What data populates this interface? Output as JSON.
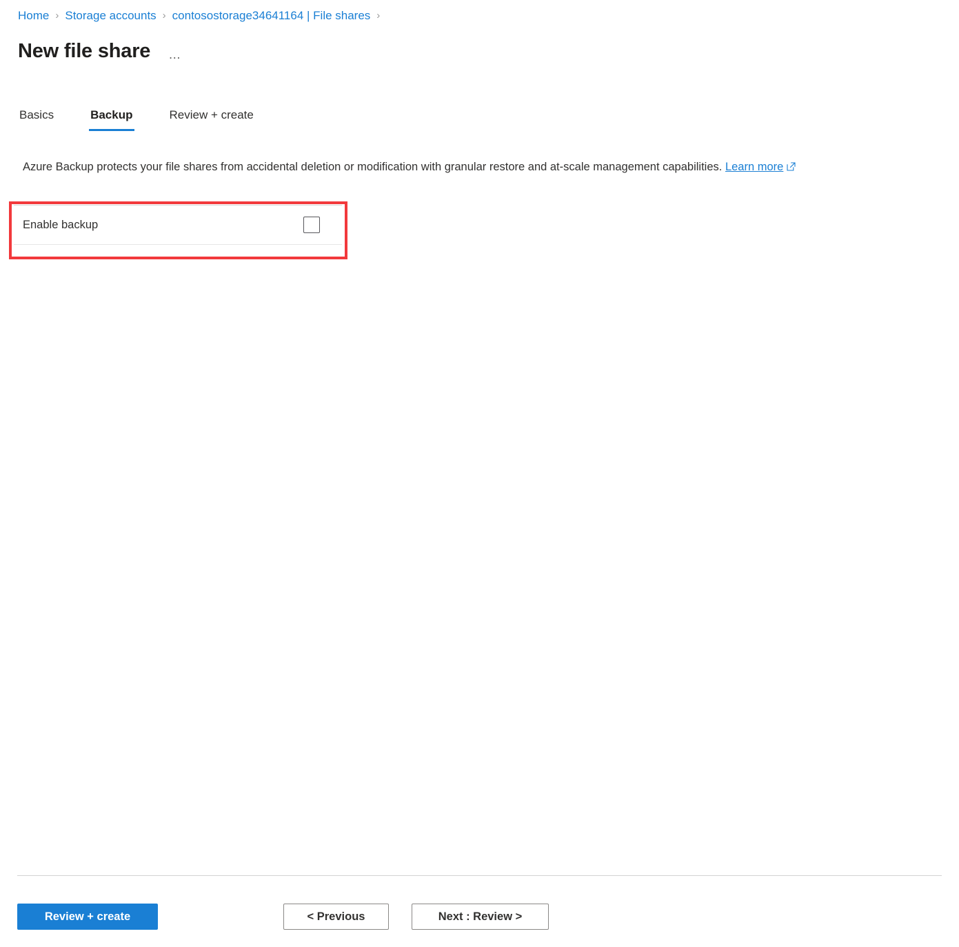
{
  "breadcrumb": {
    "items": [
      {
        "label": "Home"
      },
      {
        "label": "Storage accounts"
      },
      {
        "label": "contosostorage34641164 | File shares"
      }
    ],
    "separator": "›"
  },
  "header": {
    "title": "New file share",
    "more_label": "…"
  },
  "tabs": [
    {
      "label": "Basics",
      "active": false
    },
    {
      "label": "Backup",
      "active": true
    },
    {
      "label": "Review + create",
      "active": false
    }
  ],
  "main": {
    "description_text": "Azure Backup protects your file shares from accidental deletion or modification with granular restore and at-scale management capabilities.",
    "learn_more_label": "Learn more",
    "learn_more_icon": "external-link-icon",
    "enable_backup": {
      "label": "Enable backup",
      "checked": false,
      "checkbox_icon": "unchecked-checkbox-icon"
    }
  },
  "annotation": {
    "color": "#f2393c",
    "target": "enable-backup-row"
  },
  "footer": {
    "review_create_label": "Review + create",
    "previous_label": "< Previous",
    "next_label": "Next : Review >"
  },
  "colors": {
    "accent": "#1a7fd4",
    "link": "#1a7fd4",
    "text": "#323130",
    "annotation": "#f2393c"
  }
}
